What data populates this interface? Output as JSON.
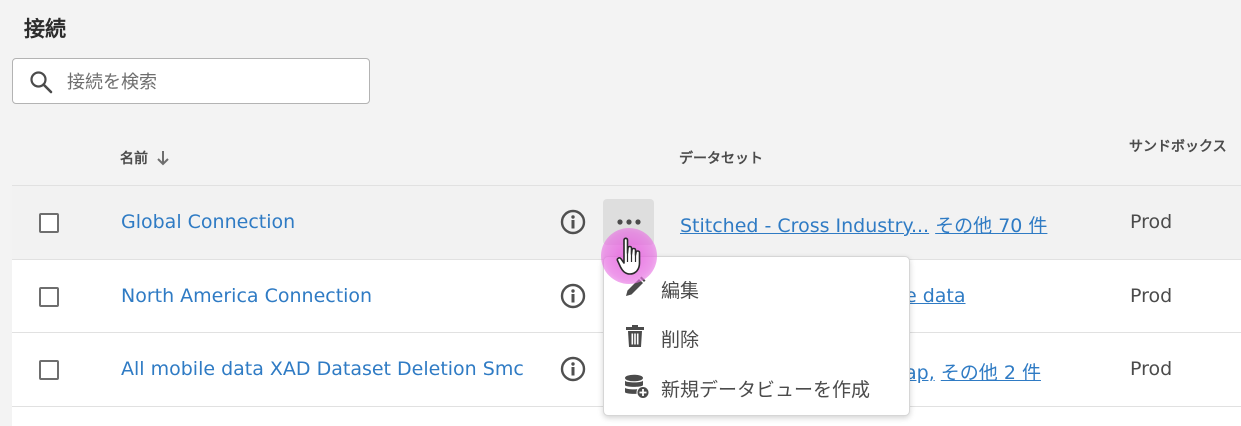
{
  "page": {
    "title": "接続"
  },
  "search": {
    "placeholder": "接続を検索",
    "value": ""
  },
  "table": {
    "headers": {
      "name": "名前",
      "dataset": "データセット",
      "sandbox": "サンドボックス"
    },
    "rows": [
      {
        "name": "Global Connection",
        "dataset_primary": "Stitched - Cross Industry...",
        "dataset_more": "その他 70 件",
        "sandbox": "Prod"
      },
      {
        "name": "North America Connection",
        "dataset_primary": "e data",
        "dataset_more": "",
        "sandbox": "Prod"
      },
      {
        "name": "All mobile data XAD Dataset Deletion Smc",
        "dataset_primary": "ap,",
        "dataset_more": "その他 2 件",
        "sandbox": "Prod"
      }
    ]
  },
  "context_menu": {
    "items": [
      {
        "label": "編集",
        "icon": "pencil-icon"
      },
      {
        "label": "削除",
        "icon": "trash-icon"
      },
      {
        "label": "新規データビューを作成",
        "icon": "database-add-icon"
      }
    ]
  },
  "colors": {
    "link": "#2f7bc4",
    "cursor_highlight": "#e65adc"
  }
}
